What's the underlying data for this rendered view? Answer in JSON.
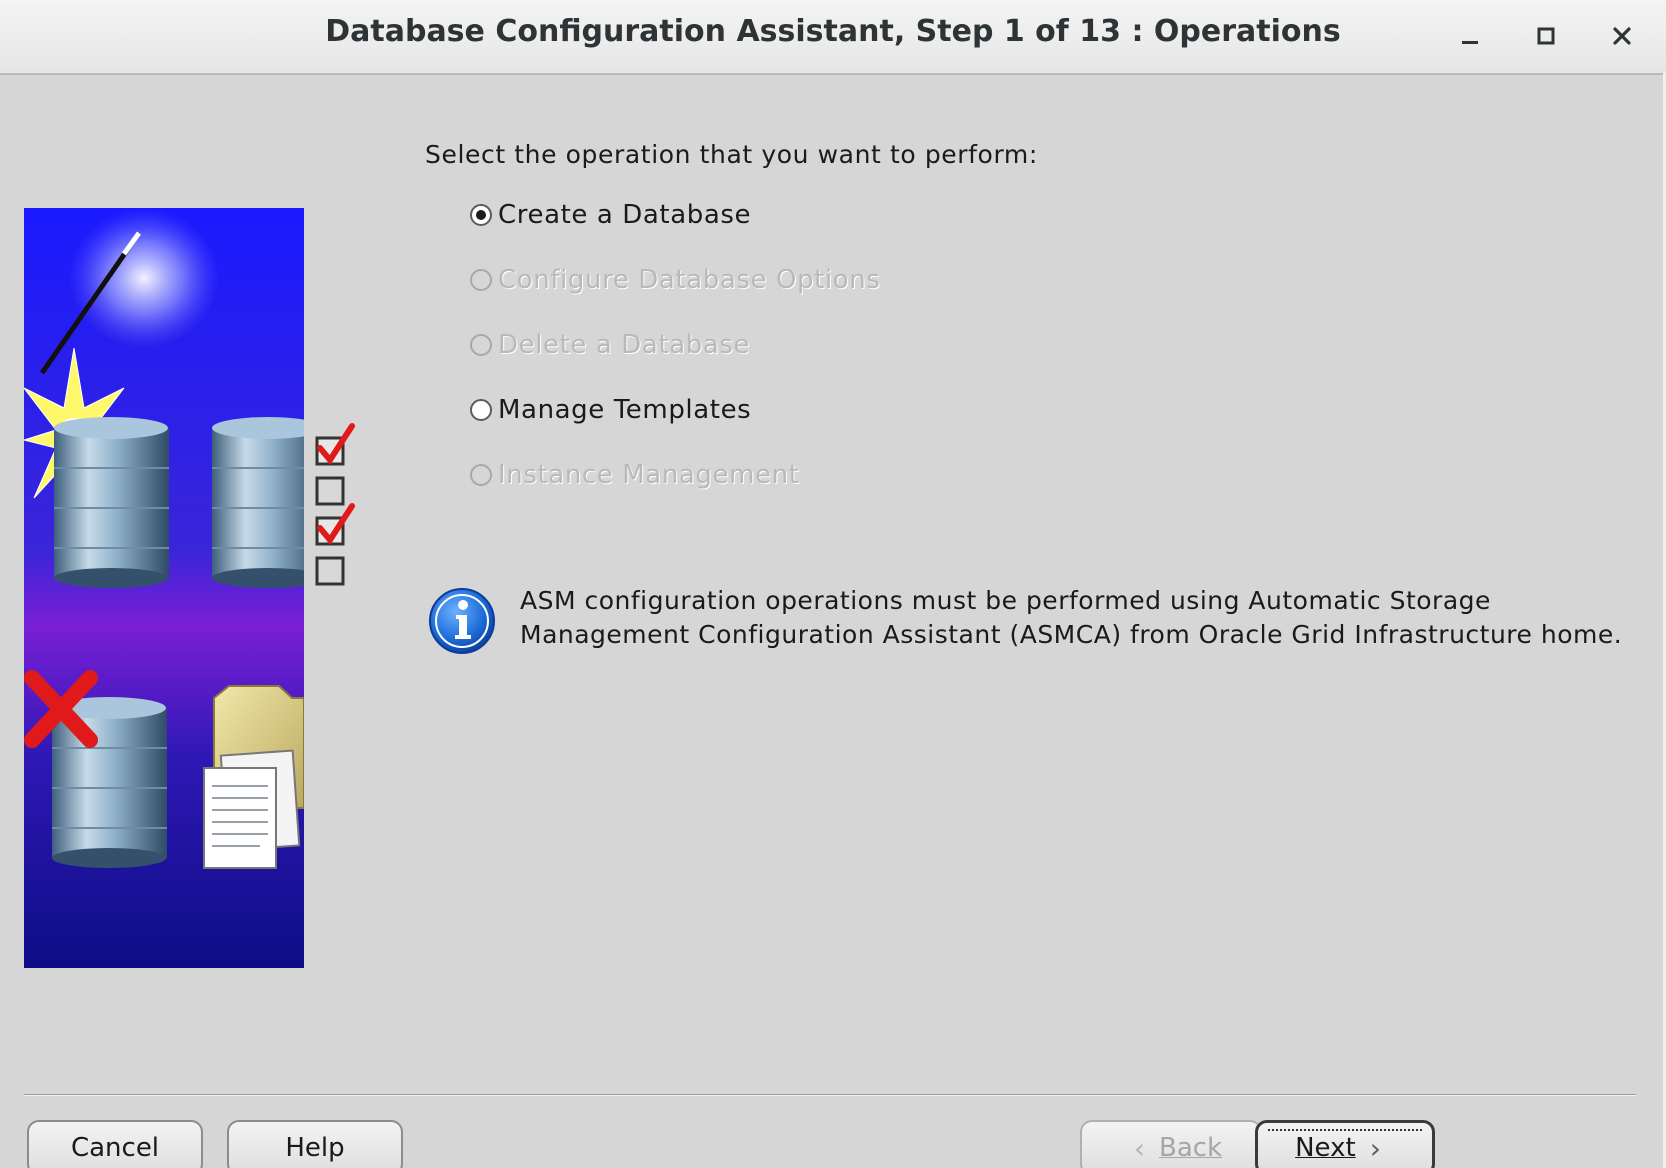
{
  "window": {
    "title": "Database Configuration Assistant, Step 1 of 13 : Operations"
  },
  "prompt": "Select the operation that you want to perform:",
  "operations": [
    {
      "label": "Create a Database",
      "selected": true,
      "enabled": true
    },
    {
      "label": "Configure Database Options",
      "selected": false,
      "enabled": false
    },
    {
      "label": "Delete a Database",
      "selected": false,
      "enabled": false
    },
    {
      "label": "Manage Templates",
      "selected": false,
      "enabled": true
    },
    {
      "label": "Instance Management",
      "selected": false,
      "enabled": false
    }
  ],
  "info": {
    "line1": "ASM configuration operations must be performed using Automatic Storage",
    "line2": "Management Configuration Assistant (ASMCA) from Oracle Grid Infrastructure home."
  },
  "buttons": {
    "cancel": "Cancel",
    "help": "Help",
    "back": "Back",
    "next": "Next"
  },
  "colors": {
    "window_bg": "#d6d6d6",
    "illustration_top": "#1a1aff",
    "illustration_mid": "#7a1fd6",
    "info_blue": "#1f6fdc"
  }
}
